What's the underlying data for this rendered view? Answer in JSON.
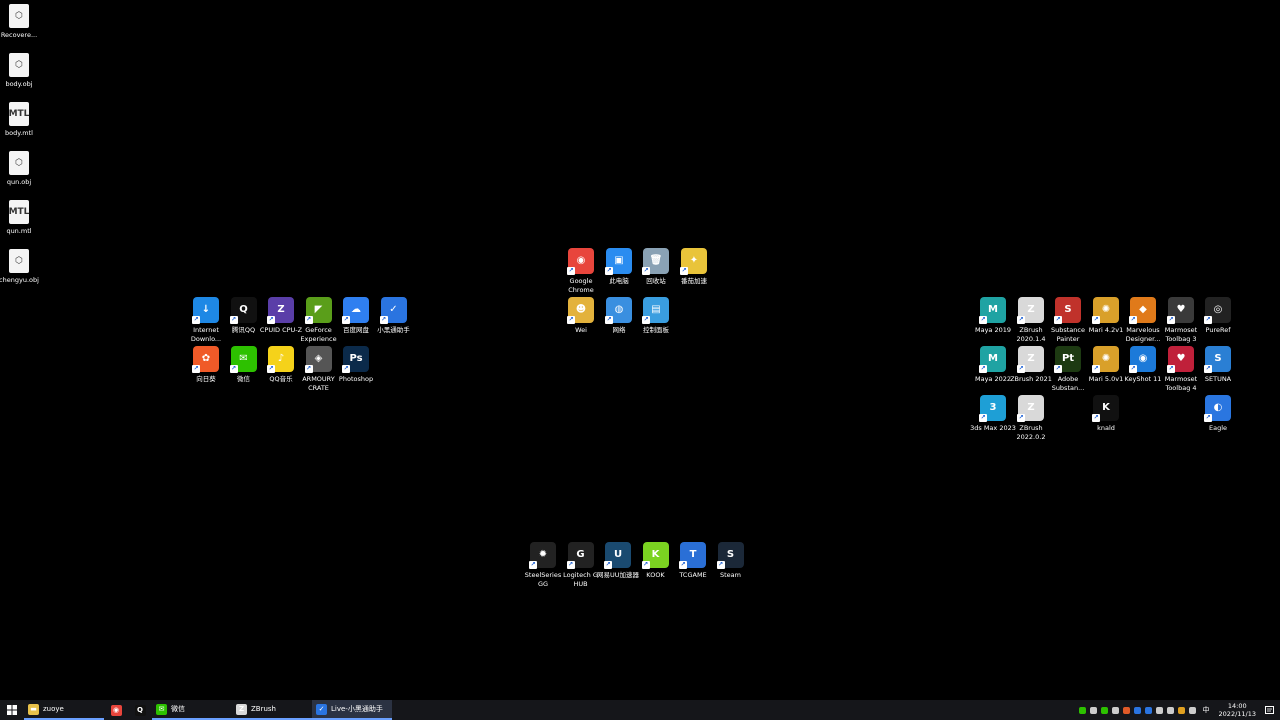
{
  "desktop": {
    "files": [
      {
        "label": "Recovere...",
        "glyph": "⬡"
      },
      {
        "label": "body.obj",
        "glyph": "⬡"
      },
      {
        "label": "body.mtl",
        "glyph": "MTL"
      },
      {
        "label": "qun.obj",
        "glyph": "⬡"
      },
      {
        "label": "qun.mtl",
        "glyph": "MTL"
      },
      {
        "label": "chengyu.obj",
        "glyph": "⬡"
      }
    ],
    "center_top": [
      {
        "label": "Google Chrome",
        "glyph": "◉",
        "color": "#e8453c"
      },
      {
        "label": "此电脑",
        "glyph": "▣",
        "color": "#2a8cf0"
      },
      {
        "label": "回收站",
        "glyph": "🗑",
        "color": "#8aa2b5"
      },
      {
        "label": "番茄加速",
        "glyph": "✦",
        "color": "#e9c43a"
      },
      {
        "label": "Wei",
        "glyph": "☻",
        "color": "#e3b23c"
      },
      {
        "label": "网络",
        "glyph": "◍",
        "color": "#3a8fe0"
      },
      {
        "label": "控制面板",
        "glyph": "▤",
        "color": "#3a9ee0"
      }
    ],
    "left_group": [
      {
        "label": "Internet Downlo...",
        "glyph": "↓",
        "color": "#1e88e5"
      },
      {
        "label": "腾讯QQ",
        "glyph": "Q",
        "color": "#111111"
      },
      {
        "label": "CPUID CPU-Z",
        "glyph": "Z",
        "color": "#5a3ea8"
      },
      {
        "label": "GeForce Experience",
        "glyph": "◤",
        "color": "#5a9e1a"
      },
      {
        "label": "百度网盘",
        "glyph": "☁",
        "color": "#2f7ff0"
      },
      {
        "label": "小黑通助手",
        "glyph": "✓",
        "color": "#2a74e0"
      },
      {
        "label": "向日葵",
        "glyph": "✿",
        "color": "#f05a28"
      },
      {
        "label": "微信",
        "glyph": "✉",
        "color": "#2dc100"
      },
      {
        "label": "QQ音乐",
        "glyph": "♪",
        "color": "#f5d21a"
      },
      {
        "label": "ARMOURY CRATE",
        "glyph": "◈",
        "color": "#555555"
      },
      {
        "label": "Photoshop",
        "glyph": "Ps",
        "color": "#0b2a4a"
      }
    ],
    "right_group": [
      {
        "label": "Maya 2019",
        "glyph": "M",
        "color": "#1fa3a3"
      },
      {
        "label": "ZBrush 2020.1.4",
        "glyph": "Z",
        "color": "#d9d9d9"
      },
      {
        "label": "Substance Painter",
        "glyph": "S",
        "color": "#c0322b"
      },
      {
        "label": "Mari 4.2v1",
        "glyph": "✺",
        "color": "#d9a02a"
      },
      {
        "label": "Marvelous Designer...",
        "glyph": "◆",
        "color": "#e07a1a"
      },
      {
        "label": "Marmoset Toolbag 3",
        "glyph": "♥",
        "color": "#3a3a3a"
      },
      {
        "label": "PureRef",
        "glyph": "◎",
        "color": "#222222"
      },
      {
        "label": "Maya 2022",
        "glyph": "M",
        "color": "#1fa3a3"
      },
      {
        "label": "ZBrush 2021",
        "glyph": "Z",
        "color": "#d9d9d9"
      },
      {
        "label": "Adobe Substan...",
        "glyph": "Pt",
        "color": "#1d3a12"
      },
      {
        "label": "Mari 5.0v1",
        "glyph": "✺",
        "color": "#d9a02a"
      },
      {
        "label": "KeyShot 11",
        "glyph": "◉",
        "color": "#1c7ad9"
      },
      {
        "label": "Marmoset Toolbag 4",
        "glyph": "♥",
        "color": "#c0203a"
      },
      {
        "label": "SETUNA",
        "glyph": "S",
        "color": "#2a7fd4"
      },
      {
        "label": "3ds Max 2023",
        "glyph": "3",
        "color": "#1e9fd6"
      },
      {
        "label": "ZBrush 2022.0.2",
        "glyph": "Z",
        "color": "#d9d9d9"
      },
      {
        "label": "knald",
        "glyph": "K",
        "color": "#111111"
      },
      {
        "label": "Eagle",
        "glyph": "◐",
        "color": "#2a76e0"
      }
    ],
    "bottom_group": [
      {
        "label": "SteelSeries GG",
        "glyph": "✹",
        "color": "#222222"
      },
      {
        "label": "Logitech G HUB",
        "glyph": "G",
        "color": "#222222"
      },
      {
        "label": "网易UU加速器",
        "glyph": "U",
        "color": "#1a4a70"
      },
      {
        "label": "KOOK",
        "glyph": "K",
        "color": "#7bd321"
      },
      {
        "label": "TCGAME",
        "glyph": "T",
        "color": "#2a6fd6"
      },
      {
        "label": "Steam",
        "glyph": "S",
        "color": "#1b2838"
      }
    ]
  },
  "taskbar": {
    "start_icon": "windows-icon",
    "apps": [
      {
        "label": "zuoye",
        "glyph": "▬",
        "color": "#e8c14a",
        "name": "folder"
      },
      {
        "label": "",
        "glyph": "◉",
        "color": "#e8453c",
        "name": "chrome"
      },
      {
        "label": "",
        "glyph": "Q",
        "color": "#111111",
        "name": "qq"
      },
      {
        "label": "微信",
        "glyph": "✉",
        "color": "#2dc100",
        "name": "wechat"
      },
      {
        "label": "ZBrush",
        "glyph": "Z",
        "color": "#d9d9d9",
        "name": "zbrush"
      },
      {
        "label": "Live-小黑通助手",
        "glyph": "✓",
        "color": "#2a74e0",
        "name": "xiaohei"
      }
    ],
    "ime": "中",
    "clock": {
      "time": "14:00",
      "date": "2022/11/13"
    },
    "tray_colors": [
      "#2dc100",
      "#cccccc",
      "#2dc100",
      "#cccccc",
      "#e05a28",
      "#2a74e0",
      "#2a74e0",
      "#cccccc",
      "#cccccc",
      "#e0a020",
      "#cccccc"
    ]
  }
}
